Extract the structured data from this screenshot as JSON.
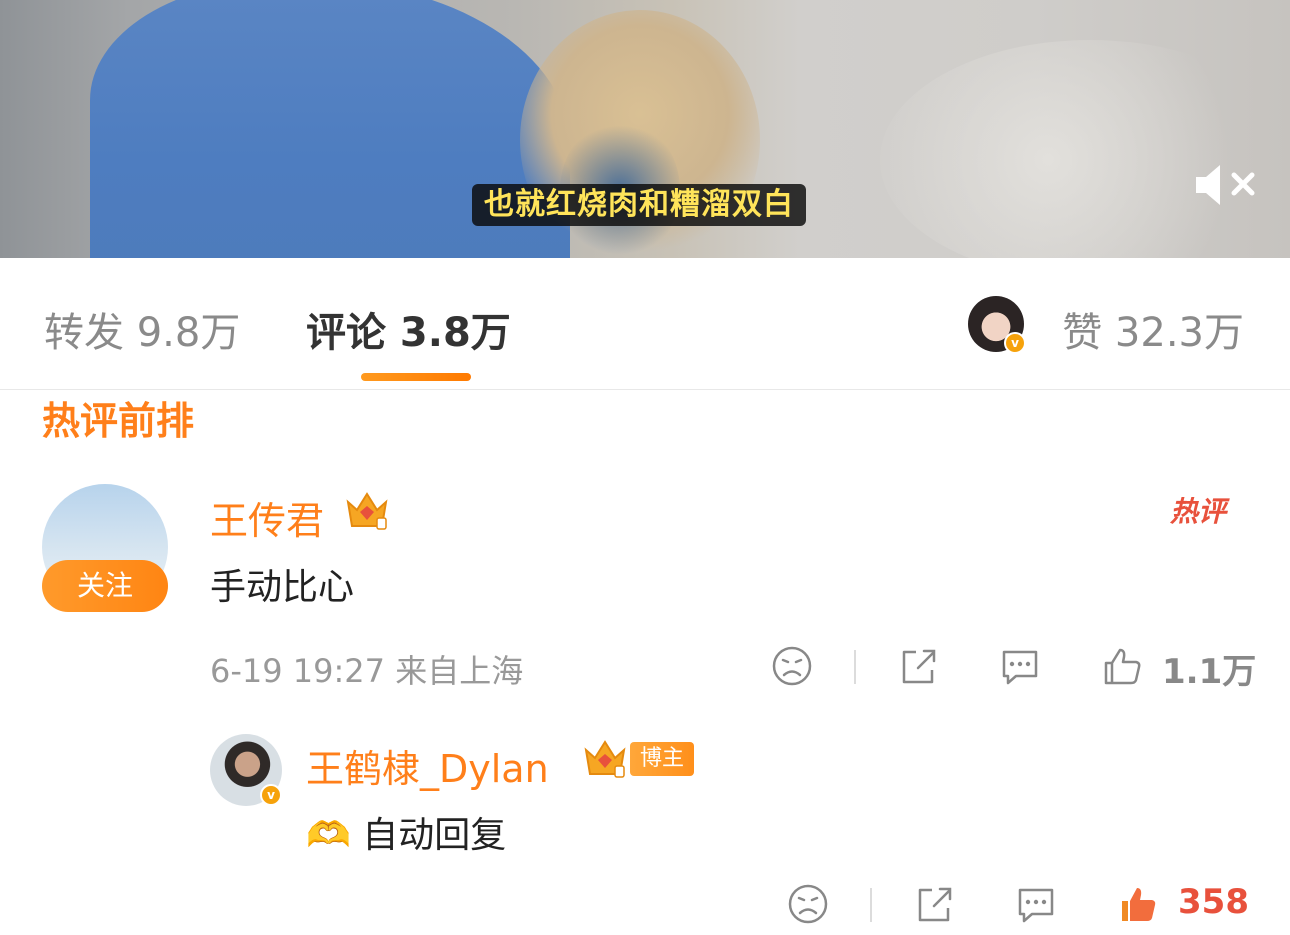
{
  "video": {
    "subtitle": "也就红烧肉和糟溜双白"
  },
  "tabs": {
    "repost": "转发 9.8万",
    "comment": "评论 3.8万",
    "likes": "赞 32.3万"
  },
  "section_title": "热评前排",
  "comments": [
    {
      "username": "王传君",
      "badge": "热评",
      "follow_label": "关注",
      "text": "手动比心",
      "meta": "6-19 19:27 来自上海",
      "like_count": "1.1万"
    }
  ],
  "reply": {
    "username": "王鹤棣_Dylan",
    "author_tag": "博主",
    "text": "🫶 自动回复",
    "like_count": "358"
  },
  "colors": {
    "accent": "#ff7f1a",
    "liked": "#e8513c",
    "subtitle": "#ffe45a"
  },
  "icons": [
    "mute-icon",
    "frown-icon",
    "share-icon",
    "comment-icon",
    "thumbs-up-icon",
    "crown-icon",
    "verified-icon"
  ]
}
